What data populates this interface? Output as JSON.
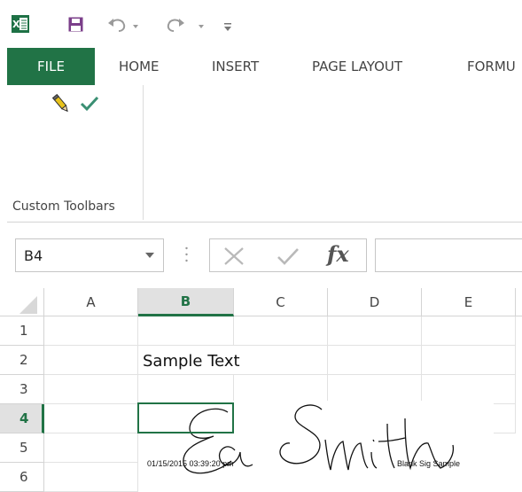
{
  "quick_access": {
    "icons": [
      "excel-logo-icon",
      "save-icon",
      "undo-icon",
      "redo-icon",
      "customize-qat-icon"
    ]
  },
  "tabs": {
    "file": "FILE",
    "home": "HOME",
    "insert": "INSERT",
    "page_layout": "PAGE LAYOUT",
    "formulas": "FORMU"
  },
  "ribbon": {
    "group_label": "Custom Toolbars",
    "buttons": [
      "pencil-icon",
      "checkmark-icon"
    ]
  },
  "formula_bar": {
    "name_box": "B4",
    "formula": ""
  },
  "grid": {
    "columns": [
      "A",
      "B",
      "C",
      "D",
      "E"
    ],
    "selected_column": "B",
    "rows": [
      "1",
      "2",
      "3",
      "4",
      "5",
      "6"
    ],
    "selected_row": "4",
    "cells": {
      "B2": "Sample Text"
    }
  },
  "signature": {
    "timestamp": "01/15/2015 03:39:20 pm",
    "caption": "Blank Sig Sample"
  },
  "colors": {
    "accent": "#217346",
    "excel_green": "#1e7145",
    "save_purple": "#7b3f8a"
  }
}
